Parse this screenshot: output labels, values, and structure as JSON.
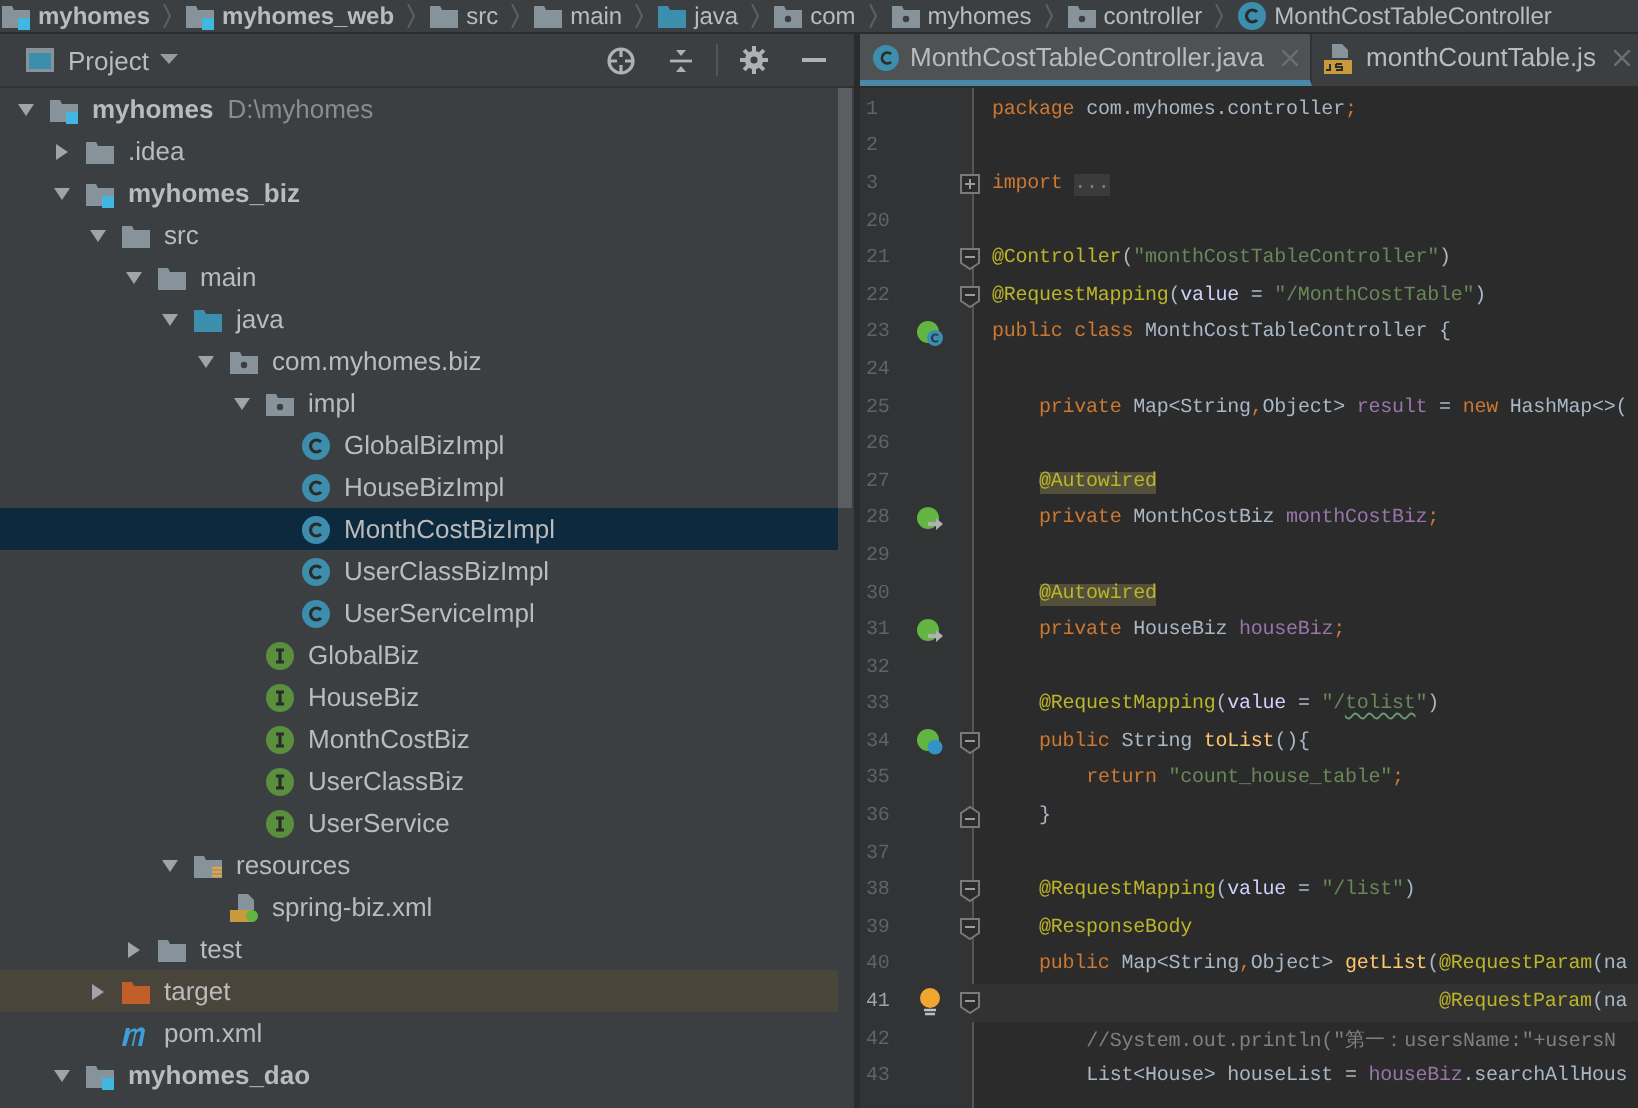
{
  "breadcrumbs": [
    {
      "label": "myhomes",
      "kind": "module"
    },
    {
      "label": "myhomes_web",
      "kind": "module"
    },
    {
      "label": "src",
      "kind": "folder"
    },
    {
      "label": "main",
      "kind": "folder"
    },
    {
      "label": "java",
      "kind": "source_folder"
    },
    {
      "label": "com",
      "kind": "package"
    },
    {
      "label": "myhomes",
      "kind": "package"
    },
    {
      "label": "controller",
      "kind": "package"
    },
    {
      "label": "MonthCostTableController",
      "kind": "class"
    }
  ],
  "project_panel": {
    "title": "Project",
    "tree": [
      {
        "label": "myhomes",
        "kind": "module",
        "path": "D:\\myhomes",
        "expanded": true,
        "selected": false,
        "children": [
          {
            "label": ".idea",
            "kind": "folder",
            "expanded": false,
            "selected": false
          },
          {
            "label": "myhomes_biz",
            "kind": "module",
            "expanded": true,
            "selected": false,
            "children": [
              {
                "label": "src",
                "kind": "folder",
                "expanded": true,
                "selected": false,
                "children": [
                  {
                    "label": "main",
                    "kind": "folder",
                    "expanded": true,
                    "selected": false,
                    "children": [
                      {
                        "label": "java",
                        "kind": "source_folder",
                        "expanded": true,
                        "selected": false,
                        "children": [
                          {
                            "label": "com.myhomes.biz",
                            "kind": "package",
                            "expanded": true,
                            "selected": false,
                            "children": [
                              {
                                "label": "impl",
                                "kind": "package",
                                "expanded": true,
                                "selected": false,
                                "children": [
                                  {
                                    "label": "GlobalBizImpl",
                                    "kind": "class",
                                    "selected": false
                                  },
                                  {
                                    "label": "HouseBizImpl",
                                    "kind": "class",
                                    "selected": false
                                  },
                                  {
                                    "label": "MonthCostBizImpl",
                                    "kind": "class",
                                    "selected": true
                                  },
                                  {
                                    "label": "UserClassBizImpl",
                                    "kind": "class",
                                    "selected": false
                                  },
                                  {
                                    "label": "UserServiceImpl",
                                    "kind": "class",
                                    "selected": false
                                  }
                                ]
                              },
                              {
                                "label": "GlobalBiz",
                                "kind": "interface",
                                "selected": false
                              },
                              {
                                "label": "HouseBiz",
                                "kind": "interface",
                                "selected": false
                              },
                              {
                                "label": "MonthCostBiz",
                                "kind": "interface",
                                "selected": false
                              },
                              {
                                "label": "UserClassBiz",
                                "kind": "interface",
                                "selected": false
                              },
                              {
                                "label": "UserService",
                                "kind": "interface",
                                "selected": false
                              }
                            ]
                          }
                        ]
                      },
                      {
                        "label": "resources",
                        "kind": "resources_folder",
                        "expanded": true,
                        "selected": false,
                        "children": [
                          {
                            "label": "spring-biz.xml",
                            "kind": "xml",
                            "selected": false
                          }
                        ]
                      }
                    ]
                  },
                  {
                    "label": "test",
                    "kind": "folder",
                    "expanded": false,
                    "selected": false
                  }
                ]
              },
              {
                "label": "target",
                "kind": "excluded_folder",
                "expanded": false,
                "selected": false
              },
              {
                "label": "pom.xml",
                "kind": "maven",
                "selected": false
              }
            ]
          },
          {
            "label": "myhomes_dao",
            "kind": "module",
            "expanded": true,
            "selected": false
          }
        ]
      }
    ]
  },
  "editor": {
    "tabs": [
      {
        "label": "MonthCostTableController.java",
        "kind": "java",
        "selected": true
      },
      {
        "label": "monthCountTable.js",
        "kind": "js",
        "selected": false
      }
    ],
    "lines": [
      {
        "number": "1",
        "current": false,
        "tokens": [
          {
            "kind": "kw",
            "text": "package"
          },
          {
            "kind": "plain",
            "text": " com.myhomes.controller"
          },
          {
            "kind": "kw",
            "text": ";"
          }
        ]
      },
      {
        "number": "2",
        "current": false
      },
      {
        "number": "3",
        "current": false,
        "fold": {
          "kind": "expand"
        },
        "tokens": [
          {
            "kind": "kw",
            "text": "import "
          },
          {
            "kind": "folded",
            "text": "..."
          }
        ]
      },
      {
        "number": "20",
        "current": false
      },
      {
        "number": "21",
        "current": false,
        "fold": {
          "kind": "start"
        },
        "tokens": [
          {
            "kind": "ann",
            "text": "@Controller"
          },
          {
            "kind": "plain",
            "text": "("
          },
          {
            "kind": "str",
            "text": "\"monthCostTableController\""
          },
          {
            "kind": "plain",
            "text": ")"
          }
        ]
      },
      {
        "number": "22",
        "current": false,
        "fold": {
          "kind": "start"
        },
        "tokens": [
          {
            "kind": "ann",
            "text": "@RequestMapping"
          },
          {
            "kind": "plain",
            "text": "("
          },
          {
            "kind": "param",
            "text": "value"
          },
          {
            "kind": "plain",
            "text": " = "
          },
          {
            "kind": "str",
            "text": "\"/MonthCostTable\""
          },
          {
            "kind": "plain",
            "text": ")"
          }
        ]
      },
      {
        "number": "23",
        "current": false,
        "marker": {
          "kind": "bean"
        },
        "tokens": [
          {
            "kind": "kw",
            "text": "public class"
          },
          {
            "kind": "plain",
            "text": " MonthCostTableController {"
          }
        ]
      },
      {
        "number": "24",
        "current": false
      },
      {
        "number": "25",
        "current": false,
        "tokens": [
          {
            "kind": "kw",
            "text": "    private"
          },
          {
            "kind": "plain",
            "text": " Map<String"
          },
          {
            "kind": "kw",
            "text": ","
          },
          {
            "kind": "plain",
            "text": "Object> "
          },
          {
            "kind": "field",
            "text": "result"
          },
          {
            "kind": "plain",
            "text": " = "
          },
          {
            "kind": "kw",
            "text": "new"
          },
          {
            "kind": "plain",
            "text": " HashMap<>("
          }
        ]
      },
      {
        "number": "26",
        "current": false
      },
      {
        "number": "27",
        "current": false,
        "tokens": [
          {
            "kind": "ann_hl",
            "text": "    @Autowired"
          }
        ]
      },
      {
        "number": "28",
        "current": false,
        "marker": {
          "kind": "inject"
        },
        "tokens": [
          {
            "kind": "kw",
            "text": "    private"
          },
          {
            "kind": "plain",
            "text": " MonthCostBiz "
          },
          {
            "kind": "field",
            "text": "monthCostBiz"
          },
          {
            "kind": "kw",
            "text": ";"
          }
        ]
      },
      {
        "number": "29",
        "current": false
      },
      {
        "number": "30",
        "current": false,
        "tokens": [
          {
            "kind": "ann_hl",
            "text": "    @Autowired"
          }
        ]
      },
      {
        "number": "31",
        "current": false,
        "marker": {
          "kind": "inject"
        },
        "tokens": [
          {
            "kind": "kw",
            "text": "    private"
          },
          {
            "kind": "plain",
            "text": " HouseBiz "
          },
          {
            "kind": "field",
            "text": "houseBiz"
          },
          {
            "kind": "kw",
            "text": ";"
          }
        ]
      },
      {
        "number": "32",
        "current": false
      },
      {
        "number": "33",
        "current": false,
        "tokens": [
          {
            "kind": "ann",
            "text": "    @RequestMapping"
          },
          {
            "kind": "plain",
            "text": "("
          },
          {
            "kind": "param",
            "text": "value"
          },
          {
            "kind": "plain",
            "text": " = "
          },
          {
            "kind": "str",
            "text": "\"/"
          },
          {
            "kind": "typo",
            "text": "tolist"
          },
          {
            "kind": "str",
            "text": "\""
          },
          {
            "kind": "plain",
            "text": ")"
          }
        ]
      },
      {
        "number": "34",
        "current": false,
        "marker": {
          "kind": "mapping"
        },
        "fold": {
          "kind": "start"
        },
        "tokens": [
          {
            "kind": "kw",
            "text": "    public"
          },
          {
            "kind": "plain",
            "text": " String "
          },
          {
            "kind": "method",
            "text": "toList"
          },
          {
            "kind": "plain",
            "text": "(){"
          }
        ]
      },
      {
        "number": "35",
        "current": false,
        "tokens": [
          {
            "kind": "kw",
            "text": "        return"
          },
          {
            "kind": "str",
            "text": " \"count_house_table\""
          },
          {
            "kind": "kw",
            "text": ";"
          }
        ]
      },
      {
        "number": "36",
        "current": false,
        "fold": {
          "kind": "end"
        },
        "tokens": [
          {
            "kind": "plain",
            "text": "    }"
          }
        ]
      },
      {
        "number": "37",
        "current": false
      },
      {
        "number": "38",
        "current": false,
        "fold": {
          "kind": "start"
        },
        "tokens": [
          {
            "kind": "ann",
            "text": "    @RequestMapping"
          },
          {
            "kind": "plain",
            "text": "("
          },
          {
            "kind": "param",
            "text": "value"
          },
          {
            "kind": "plain",
            "text": " = "
          },
          {
            "kind": "str",
            "text": "\"/list\""
          },
          {
            "kind": "plain",
            "text": ")"
          }
        ]
      },
      {
        "number": "39",
        "current": false,
        "fold": {
          "kind": "start"
        },
        "tokens": [
          {
            "kind": "ann",
            "text": "    @ResponseBody"
          }
        ]
      },
      {
        "number": "40",
        "current": false,
        "tokens": [
          {
            "kind": "kw",
            "text": "    public"
          },
          {
            "kind": "plain",
            "text": " Map<String"
          },
          {
            "kind": "kw",
            "text": ","
          },
          {
            "kind": "plain",
            "text": "Object> "
          },
          {
            "kind": "method",
            "text": "getList"
          },
          {
            "kind": "plain",
            "text": "("
          },
          {
            "kind": "ann",
            "text": "@RequestParam"
          },
          {
            "kind": "plain",
            "text": "(na"
          }
        ]
      },
      {
        "number": "41",
        "current": true,
        "marker": {
          "kind": "bulb"
        },
        "fold": {
          "kind": "start"
        },
        "tokens": [
          {
            "kind": "ann",
            "text": "                                      @RequestParam"
          },
          {
            "kind": "plain",
            "text": "(na"
          }
        ]
      },
      {
        "number": "42",
        "current": false,
        "tokens": [
          {
            "kind": "comment",
            "text": "        //System.out.println(\"第一：usersName:\"+usersN"
          }
        ]
      },
      {
        "number": "43",
        "current": false,
        "tokens": [
          {
            "kind": "plain",
            "text": "        List<House> houseList = "
          },
          {
            "kind": "field",
            "text": "houseBiz"
          },
          {
            "kind": "plain",
            "text": ".searchAllHous"
          }
        ]
      }
    ]
  }
}
